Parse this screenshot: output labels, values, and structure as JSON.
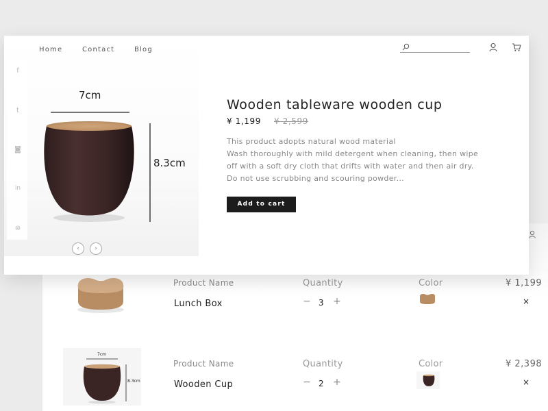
{
  "nav": {
    "home": "Home",
    "contact": "Contact",
    "blog": "Blog"
  },
  "search": {
    "placeholder": ""
  },
  "social": [
    "facebook-icon",
    "twitter-icon",
    "instagram-icon",
    "linkedin-icon",
    "dribbble-icon"
  ],
  "social_glyphs": {
    "facebook": "f",
    "twitter": "t",
    "instagram": "◙",
    "linkedin": "in",
    "dribbble": "⊛"
  },
  "product": {
    "width_label": "7cm",
    "height_label": "8.3cm",
    "title": "Wooden tableware wooden cup",
    "price": "¥ 1,199",
    "old_price": "¥ 2,599",
    "description": [
      "This product adopts natural wood material",
      "Wash thoroughly with mild detergent when cleaning, then wipe",
      "off with a soft dry cloth that drifts with water and then air dry.",
      "Do not use scrubbing and scouring powder..."
    ],
    "add_to_cart": "Add to cart"
  },
  "carousel": {
    "prev": "‹",
    "next": "›"
  },
  "cart": {
    "items": [
      {
        "name_label": "Product Name",
        "name": "Lunch Box",
        "qty_label": "Quantity",
        "minus": "−",
        "qty": "3",
        "plus": "+",
        "color_label": "Color",
        "price": "¥ 1,199",
        "remove": "×"
      },
      {
        "name_label": "Product Name",
        "name": "Wooden Cup",
        "qty_label": "Quantity",
        "minus": "−",
        "qty": "2",
        "plus": "+",
        "color_label": "Color",
        "price": "¥ 2,398",
        "remove": "×",
        "thumb_width_label": "7cm",
        "thumb_height_label": "8.3cm"
      }
    ]
  },
  "colors": {
    "wood_dark": "#3a2424",
    "wood_light": "#c9a27a",
    "button": "#1c1c1c"
  }
}
